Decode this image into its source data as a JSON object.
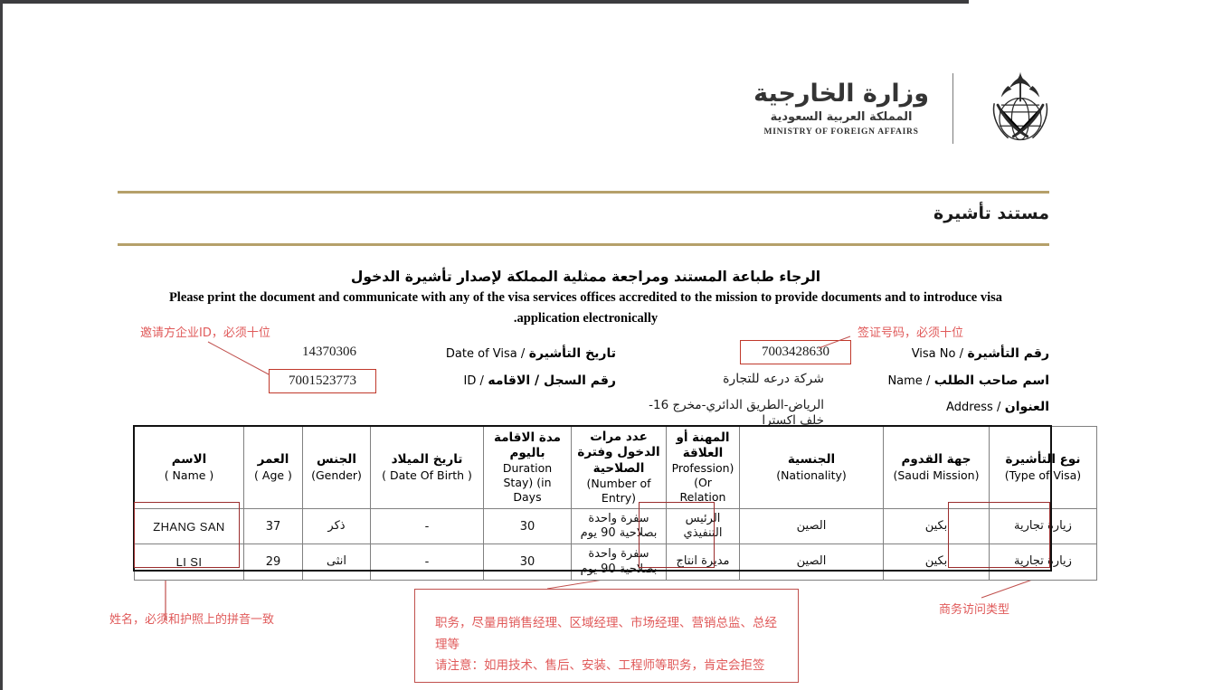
{
  "masthead": {
    "ministry_ar_primary": "وزارة الخارجية",
    "ministry_ar_secondary": "المملكة العربية السعودية",
    "ministry_en": "MINISTRY OF FOREIGN AFFAIRS",
    "emblem_name": "saudi-emblem-palm-swords-globe"
  },
  "header": {
    "document_title": "مستند تأشيرة",
    "rule_color": "#b5a06a"
  },
  "notice": {
    "arabic": "الرجاء طباعة المستند ومراجعة ممثلية المملكة لإصدار تأشيرة الدخول",
    "english_line1": "Please print the document and communicate with any of the visa services offices accredited to the mission to provide documents and to introduce visa",
    "english_line2": ".application electronically"
  },
  "fields": {
    "visa_no": {
      "label_ar": "رقم التأشيرة",
      "label_en": "Visa No",
      "value": "7003428630",
      "boxed": true
    },
    "name": {
      "label_ar": "اسم صاحب الطلب",
      "label_en": "Name",
      "value": "شركة درعه للتجارة"
    },
    "address": {
      "label_ar": "العنوان",
      "label_en": "Address",
      "value": "الرياض-الطريق الدائري-مخرج 16-خلف اكسترا"
    },
    "date_of_visa": {
      "label_ar": "تاريخ التأشيرة",
      "label_en": "Date of Visa",
      "value": "14370306"
    },
    "id": {
      "label_ar": "رقم السجل / الاقامه",
      "label_en": "ID",
      "value": "7001523773",
      "boxed": true
    }
  },
  "table": {
    "columns": [
      {
        "ar": "الاسم",
        "en": "( Name )"
      },
      {
        "ar": "العمر",
        "en": "( Age )"
      },
      {
        "ar": "الجنس",
        "en": "(Gender)"
      },
      {
        "ar": "تاريخ الميلاد",
        "en": "( Date Of Birth )"
      },
      {
        "ar": "مدة الاقامة باليوم",
        "en": "Duration Stay) (in Days"
      },
      {
        "ar": "عدد مرات الدخول وفترة الصلاحية",
        "en": "(Number of Entry)"
      },
      {
        "ar": "المهنة أو العلاقة",
        "en": "Profession) (Or Relation"
      },
      {
        "ar": "الجنسية",
        "en": "(Nationality)"
      },
      {
        "ar": "جهة القدوم",
        "en": "(Saudi Mission)"
      },
      {
        "ar": "نوع التأشيرة",
        "en": "(Type of Visa)"
      }
    ],
    "rows": [
      {
        "name": "ZHANG SAN",
        "age": "37",
        "gender": "ذكر",
        "dob": "-",
        "duration": "30",
        "entries": "سفرة واحدة بصلاحية 90 يوم",
        "profession": "الرئيس التنفيذي",
        "nationality": "الصين",
        "mission": "بكين",
        "visa_type": "زيارة تجارية"
      },
      {
        "name": "LI  SI",
        "age": "29",
        "gender": "انثى",
        "dob": "-",
        "duration": "30",
        "entries": "سفرة واحدة بصلاحية 90 يوم",
        "profession": "مديرة انتاج",
        "nationality": "الصين",
        "mission": "بكين",
        "visa_type": "زيارة تجارية"
      }
    ]
  },
  "annotations": {
    "color": "#e05a5a",
    "box_border_color": "#c0504d",
    "inviter_id": "邀请方企业ID，必须十位",
    "visa_number": "签证号码，必须十位",
    "name_note": "姓名，必须和护照上的拼音一致",
    "visa_type_note": "商务访问类型",
    "profession_note_line1": "职务，尽量用销售经理、区域经理、市场经理、营销总监、总经",
    "profession_note_line2": "理等",
    "profession_note_line3": "请注意：如用技术、售后、安装、工程师等职务，肯定会拒签"
  }
}
